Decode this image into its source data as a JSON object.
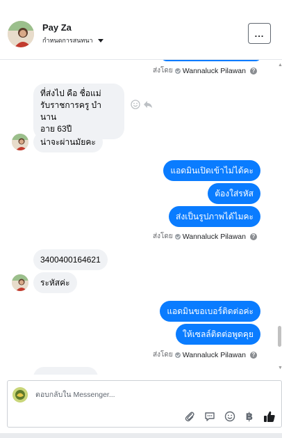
{
  "header": {
    "name": "Pay Za",
    "subtitle": "กำหนดการสนทนา",
    "more_label": "..."
  },
  "sent_by_label": "ส่งโดย",
  "sent_by_name": "Wannaluck Pilawan",
  "thread": {
    "incoming_1_lines": [
      "ที่ส่งไป คือ ชื่อแม่",
      "รับราชการครู บำนาน",
      "อายุ 63ปี"
    ],
    "incoming_2": "น่าจะผ่านมัยคะ",
    "outgoing_1": "แอดมินเปิดเข้าไม่ได้คะ",
    "outgoing_2": "ต้องใส่รหัส",
    "outgoing_3": "ส่งเป็นรูปภาพได้ไมคะ",
    "incoming_3": "3400400164621",
    "incoming_4": "ระหัสค่ะ",
    "outgoing_4": "แอดมินขอเบอร์ติดต่อค่ะ",
    "outgoing_5": "ให้เซลล์ติดต่อพูดคุย"
  },
  "composer": {
    "placeholder": "ตอบกลับใน Messenger..."
  },
  "icons": [
    "more-icon",
    "verified-check-icon",
    "help-icon",
    "emoji-icon",
    "reply-icon",
    "attach-icon",
    "sticker-icon",
    "smiley-icon",
    "baht-icon",
    "like-icon"
  ],
  "colors": {
    "accent": "#0a7cff",
    "incoming_bubble": "#f0f2f5",
    "muted_text": "#65676b"
  }
}
